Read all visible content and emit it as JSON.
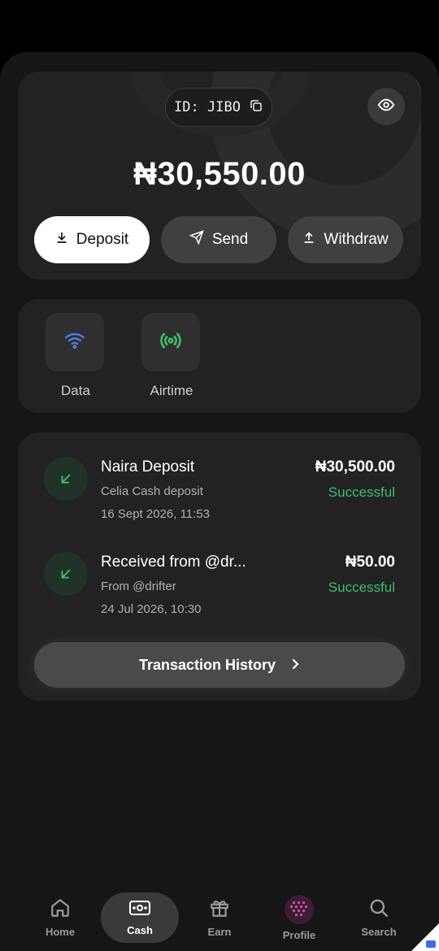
{
  "account": {
    "id_label": "ID: JIBO",
    "balance": "₦30,550.00"
  },
  "actions": {
    "deposit": "Deposit",
    "send": "Send",
    "withdraw": "Withdraw"
  },
  "services": [
    {
      "label": "Data",
      "icon": "wifi-icon"
    },
    {
      "label": "Airtime",
      "icon": "signal-icon"
    }
  ],
  "transactions": [
    {
      "title": "Naira Deposit",
      "subtitle": "Celia Cash deposit",
      "date": "16 Sept 2026, 11:53",
      "amount": "₦30,500.00",
      "status": "Successful"
    },
    {
      "title": "Received from @dr...",
      "subtitle": "From @drifter",
      "date": "24 Jul 2026, 10:30",
      "amount": "₦50.00",
      "status": "Successful"
    }
  ],
  "history_button": "Transaction History",
  "nav": {
    "home": "Home",
    "cash": "Cash",
    "earn": "Earn",
    "profile": "Profile",
    "search": "Search"
  },
  "colors": {
    "accent_green": "#3fbf6f",
    "wifi_blue": "#4a7fe0",
    "background": "#161616"
  }
}
